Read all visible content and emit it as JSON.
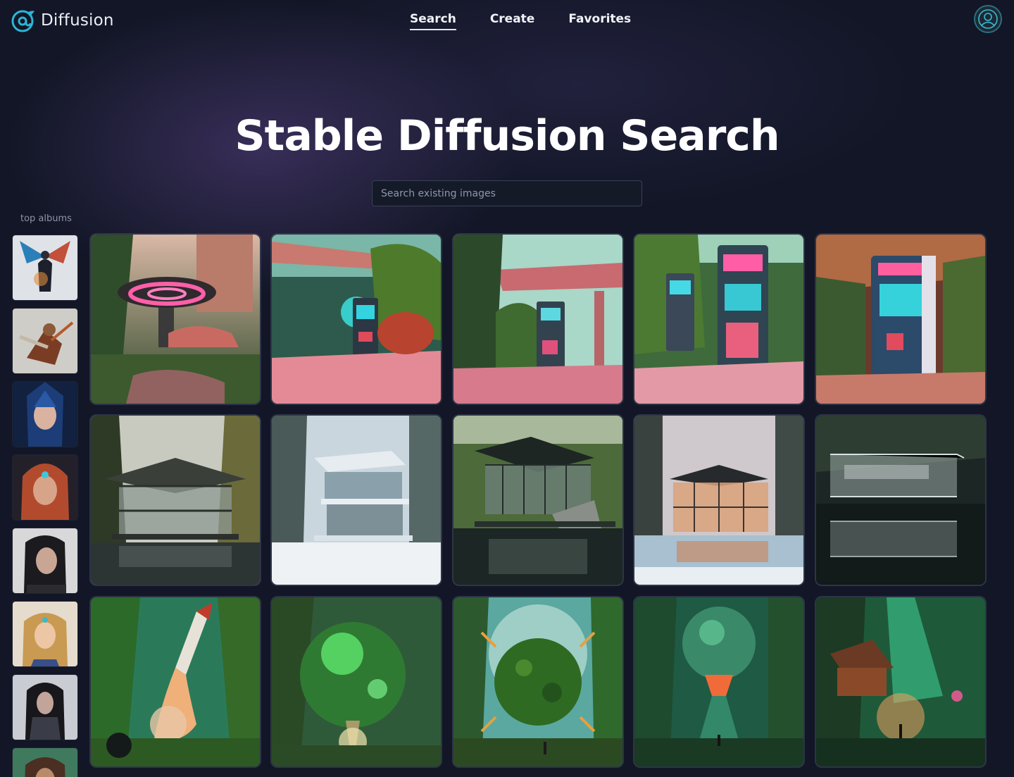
{
  "header": {
    "brand_name": "Diffusion",
    "nav": [
      {
        "label": "Search",
        "active": true
      },
      {
        "label": "Create",
        "active": false
      },
      {
        "label": "Favorites",
        "active": false
      }
    ]
  },
  "hero": {
    "title": "Stable Diffusion Search",
    "search_placeholder": "Search existing images"
  },
  "albums": {
    "label": "top albums",
    "items": [
      {
        "subject": "winged dark warrior"
      },
      {
        "subject": "armored warrior"
      },
      {
        "subject": "blue sorceress"
      },
      {
        "subject": "tribal woman portrait"
      },
      {
        "subject": "dark haired woman portrait"
      },
      {
        "subject": "elf woman portrait"
      },
      {
        "subject": "armored dark elf"
      },
      {
        "subject": "green fantasy heroine"
      }
    ]
  },
  "grid": {
    "rows": [
      {
        "theme": "retro neon jungle",
        "images": [
          {
            "subject": "neon ring tower and retro car in jungle"
          },
          {
            "subject": "arcade cabinet under concrete overhang"
          },
          {
            "subject": "arcade cabinet in overgrown plaza"
          },
          {
            "subject": "two arcade cabinets in foliage"
          },
          {
            "subject": "arcade cabinet in red jungle"
          }
        ]
      },
      {
        "theme": "glass house in forest",
        "images": [
          {
            "subject": "glass pavilion on lake"
          },
          {
            "subject": "glass house in snowy forest"
          },
          {
            "subject": "glass house over pond"
          },
          {
            "subject": "glowing glass house in winter"
          },
          {
            "subject": "glass house reflected in dark water"
          }
        ]
      },
      {
        "theme": "green sci-fi forest",
        "images": [
          {
            "subject": "rocket launching from forest"
          },
          {
            "subject": "green planet sphere in forest"
          },
          {
            "subject": "exploding green sphere"
          },
          {
            "subject": "hovering green orb"
          },
          {
            "subject": "glowing jungle beam"
          }
        ]
      }
    ]
  },
  "colors": {
    "background": "#121626",
    "accent": "#2bb5d6",
    "nav_underline": "#dfe6f2"
  }
}
